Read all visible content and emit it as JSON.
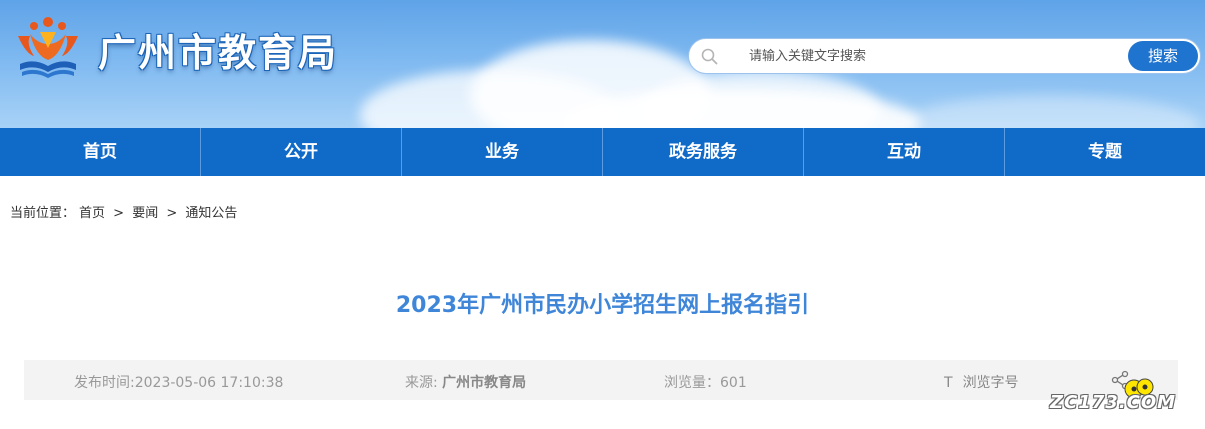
{
  "header": {
    "site_title": "广州市教育局",
    "logo_icon": "education-bureau-logo-icon"
  },
  "search": {
    "placeholder": "请输入关键文字搜索",
    "button_label": "搜索"
  },
  "nav": {
    "items": [
      {
        "label": "首页"
      },
      {
        "label": "公开"
      },
      {
        "label": "业务"
      },
      {
        "label": "政务服务"
      },
      {
        "label": "互动"
      },
      {
        "label": "专题"
      }
    ]
  },
  "breadcrumb": {
    "prefix": "当前位置：",
    "items": [
      "首页",
      "要闻",
      "通知公告"
    ],
    "separator": ">"
  },
  "article": {
    "title": "2023年广州市民办小学招生网上报名指引",
    "publish_label": "发布时间:2023-05-06 17:10:38",
    "source_label": "来源:",
    "source_value": "广州市教育局",
    "views_label": "浏览量：601",
    "font_size_icon": "T",
    "font_size_label": "浏览字号",
    "share_icon": "share-icon"
  },
  "watermark": {
    "text": "ZC173.COM"
  },
  "colors": {
    "nav_bg": "#0f6ac8",
    "title_blue": "#3f86d9",
    "search_button": "#1f74cf"
  }
}
